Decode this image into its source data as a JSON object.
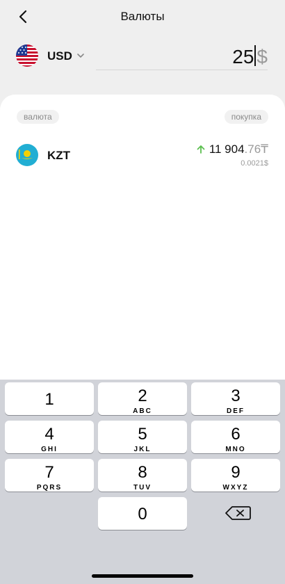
{
  "header": {
    "title": "Валюты",
    "back_icon": "chevron-left-icon"
  },
  "source": {
    "currency": "USD",
    "flag_icon": "us-flag-icon",
    "dropdown_icon": "chevron-down-icon"
  },
  "amount": {
    "value": "25",
    "symbol": "$"
  },
  "columns": {
    "left": "валюта",
    "right": "покупка"
  },
  "rates": [
    {
      "code": "KZT",
      "flag_icon": "kz-flag-icon",
      "trend_icon": "arrow-up-icon",
      "trend_color": "#5bbf4f",
      "rate_int": "11 904",
      "rate_frac": ".76₸",
      "inverse": "0.0021$"
    }
  ],
  "keypad": {
    "keys": [
      {
        "digit": "1",
        "letters": ""
      },
      {
        "digit": "2",
        "letters": "ABC"
      },
      {
        "digit": "3",
        "letters": "DEF"
      },
      {
        "digit": "4",
        "letters": "GHI"
      },
      {
        "digit": "5",
        "letters": "JKL"
      },
      {
        "digit": "6",
        "letters": "MNO"
      },
      {
        "digit": "7",
        "letters": "PQRS"
      },
      {
        "digit": "8",
        "letters": "TUV"
      },
      {
        "digit": "9",
        "letters": "WXYZ"
      },
      {
        "digit": "0",
        "letters": ""
      }
    ],
    "delete_icon": "backspace-icon"
  },
  "colors": {
    "accent_up": "#5bbf4f",
    "kz_flag": "#21aed3",
    "muted": "#9a9a9a"
  }
}
